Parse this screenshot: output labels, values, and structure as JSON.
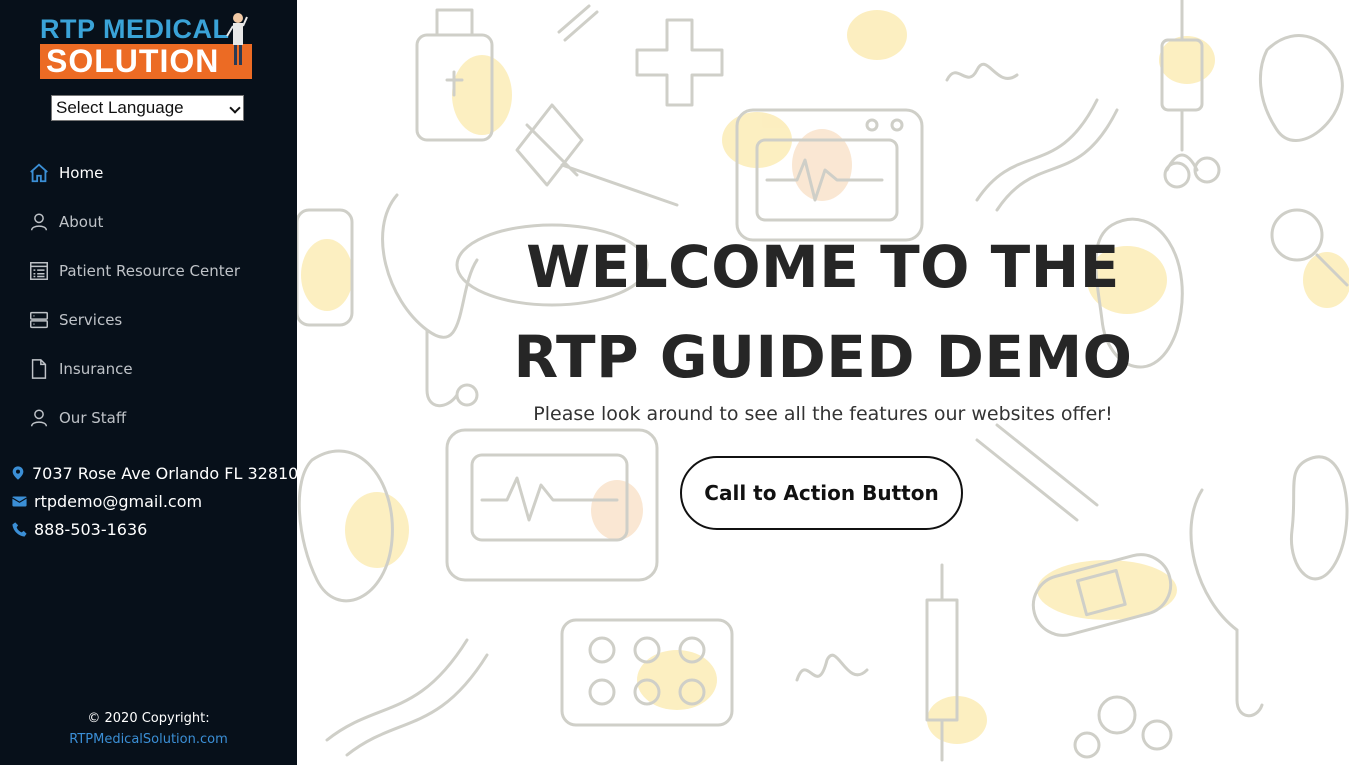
{
  "brand": {
    "logo_line1": "RTP MEDICAL",
    "logo_line2": "SOLUTION",
    "accent_blue": "#3aa3d8",
    "accent_orange": "#ec6b24"
  },
  "language_select": {
    "selected": "Select Language"
  },
  "nav": {
    "items": [
      {
        "label": "Home",
        "icon": "home-icon",
        "active": true
      },
      {
        "label": "About",
        "icon": "user-icon",
        "active": false
      },
      {
        "label": "Patient Resource Center",
        "icon": "document-list-icon",
        "active": false
      },
      {
        "label": "Services",
        "icon": "server-icon",
        "active": false
      },
      {
        "label": "Insurance",
        "icon": "file-icon",
        "active": false
      },
      {
        "label": "Our Staff",
        "icon": "user-icon",
        "active": false
      }
    ]
  },
  "contact": {
    "address": "7037 Rose Ave Orlando FL 32810",
    "email": "rtpdemo@gmail.com",
    "phone": "888-503-1636"
  },
  "footer": {
    "copyright": "© 2020 Copyright:",
    "link": "RTPMedicalSolution.com"
  },
  "hero": {
    "title_line1": "WELCOME TO THE",
    "title_line2": "RTP GUIDED DEMO",
    "subtitle": "Please look around to see all the features our websites offer!",
    "cta_label": "Call to Action Button"
  },
  "colors": {
    "sidebar_bg": "#07101a",
    "link_blue": "#3b8fd6"
  }
}
